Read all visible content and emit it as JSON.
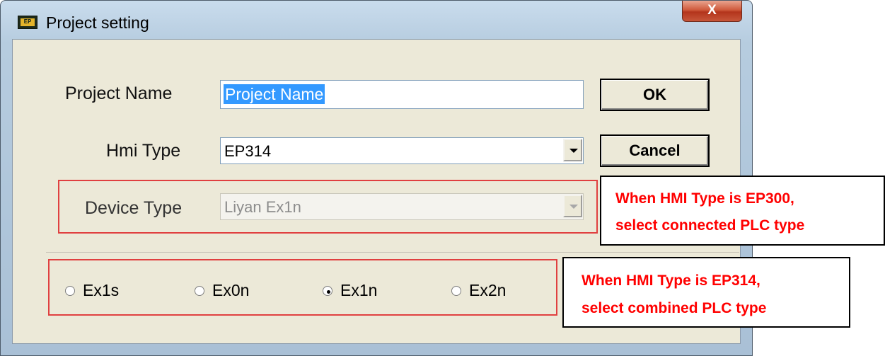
{
  "window": {
    "icon_label": "EP",
    "title": "Project setting",
    "close_glyph": "X"
  },
  "form": {
    "project_name_label": "Project Name",
    "project_name_value": "Project Name",
    "hmi_type_label": "Hmi Type",
    "hmi_type_value": "EP314",
    "device_type_label": "Device Type",
    "device_type_value": "Liyan Ex1n",
    "ok_label": "OK",
    "cancel_label": "Cancel"
  },
  "radios": [
    {
      "label": "Ex1s",
      "selected": false
    },
    {
      "label": "Ex0n",
      "selected": false
    },
    {
      "label": "Ex1n",
      "selected": true
    },
    {
      "label": "Ex2n",
      "selected": false
    }
  ],
  "annotations": {
    "callout1_line1": "When HMI Type is EP300,",
    "callout1_line2": "select connected PLC type",
    "callout2_line1": "When HMI Type is EP314,",
    "callout2_line2": "select combined PLC type",
    "highlight_color": "#e04040",
    "text_color": "#ff0000"
  }
}
